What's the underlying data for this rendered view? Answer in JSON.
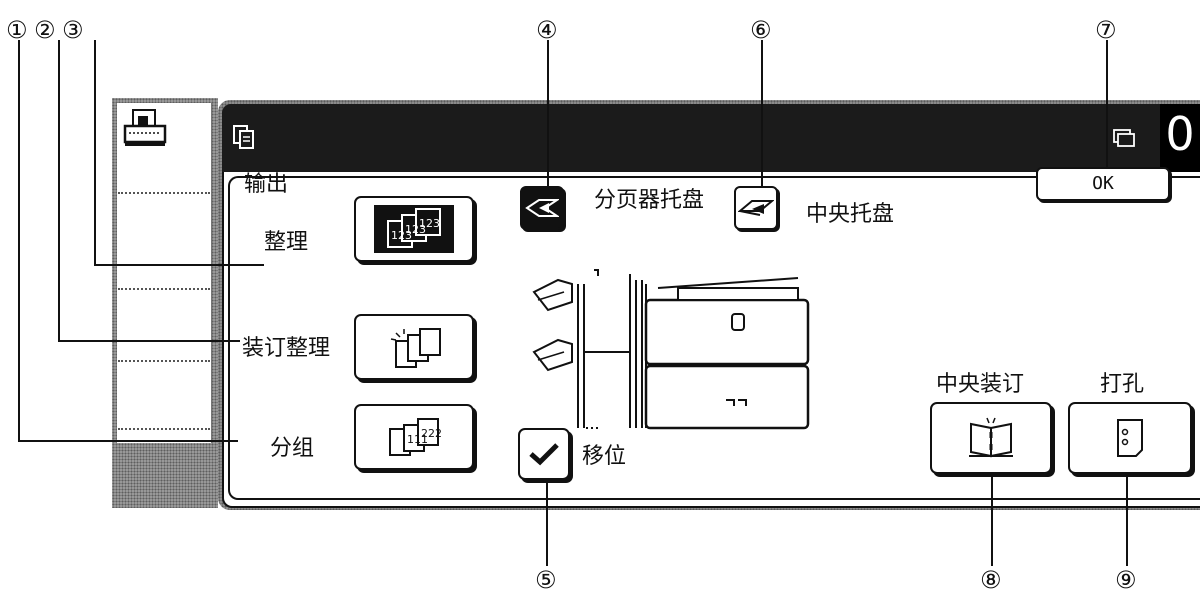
{
  "callouts": {
    "c1": "①",
    "c2": "②",
    "c3": "③",
    "c4": "④",
    "c5": "⑤",
    "c6": "⑥",
    "c7": "⑦",
    "c8": "⑧",
    "c9": "⑨"
  },
  "header": {
    "counter": "0"
  },
  "output": {
    "title": "输出",
    "sort_label": "整理",
    "staple_sort_label": "装订整理",
    "group_label": "分组",
    "selected": "sort"
  },
  "trays": {
    "offset_tray_label": "分页器托盘",
    "center_tray_label": "中央托盘",
    "selected": "offset_tray"
  },
  "offset": {
    "label": "移位",
    "checked": true
  },
  "ok_label": "OK",
  "finishing": {
    "saddle_stitch_label": "中央装订",
    "punch_label": "打孔"
  },
  "icons": {
    "printer": "printer-icon",
    "copy": "copy-mode-icon",
    "job_queue": "job-queue-icon",
    "sort": "sort-icon",
    "staple_sort": "staple-sort-icon",
    "group": "group-icon",
    "offset_tray": "offset-tray-icon",
    "center_tray": "center-tray-icon",
    "check": "checkmark-icon",
    "saddle_stitch": "saddle-stitch-icon",
    "punch": "punch-icon"
  }
}
